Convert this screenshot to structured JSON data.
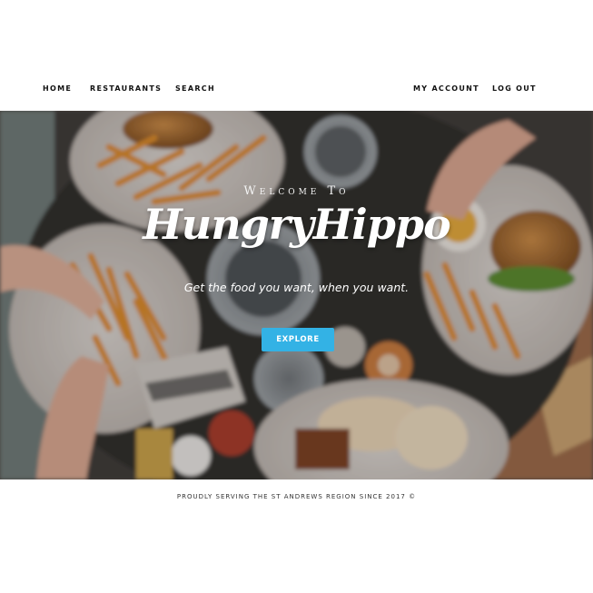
{
  "nav": {
    "left": [
      "HOME",
      "RESTAURANTS",
      "SEARCH"
    ],
    "right": [
      "MY ACCOUNT",
      "LOG OUT"
    ]
  },
  "hero": {
    "welcome": "Welcome To",
    "brand": "HungryHippo",
    "tagline": "Get the food you want, when you want.",
    "cta_label": "EXPLORE",
    "cta_color": "#33b2e5"
  },
  "footer": {
    "text": "PROUDLY SERVING THE ST ANDREWS REGION SINCE 2017 ©"
  }
}
